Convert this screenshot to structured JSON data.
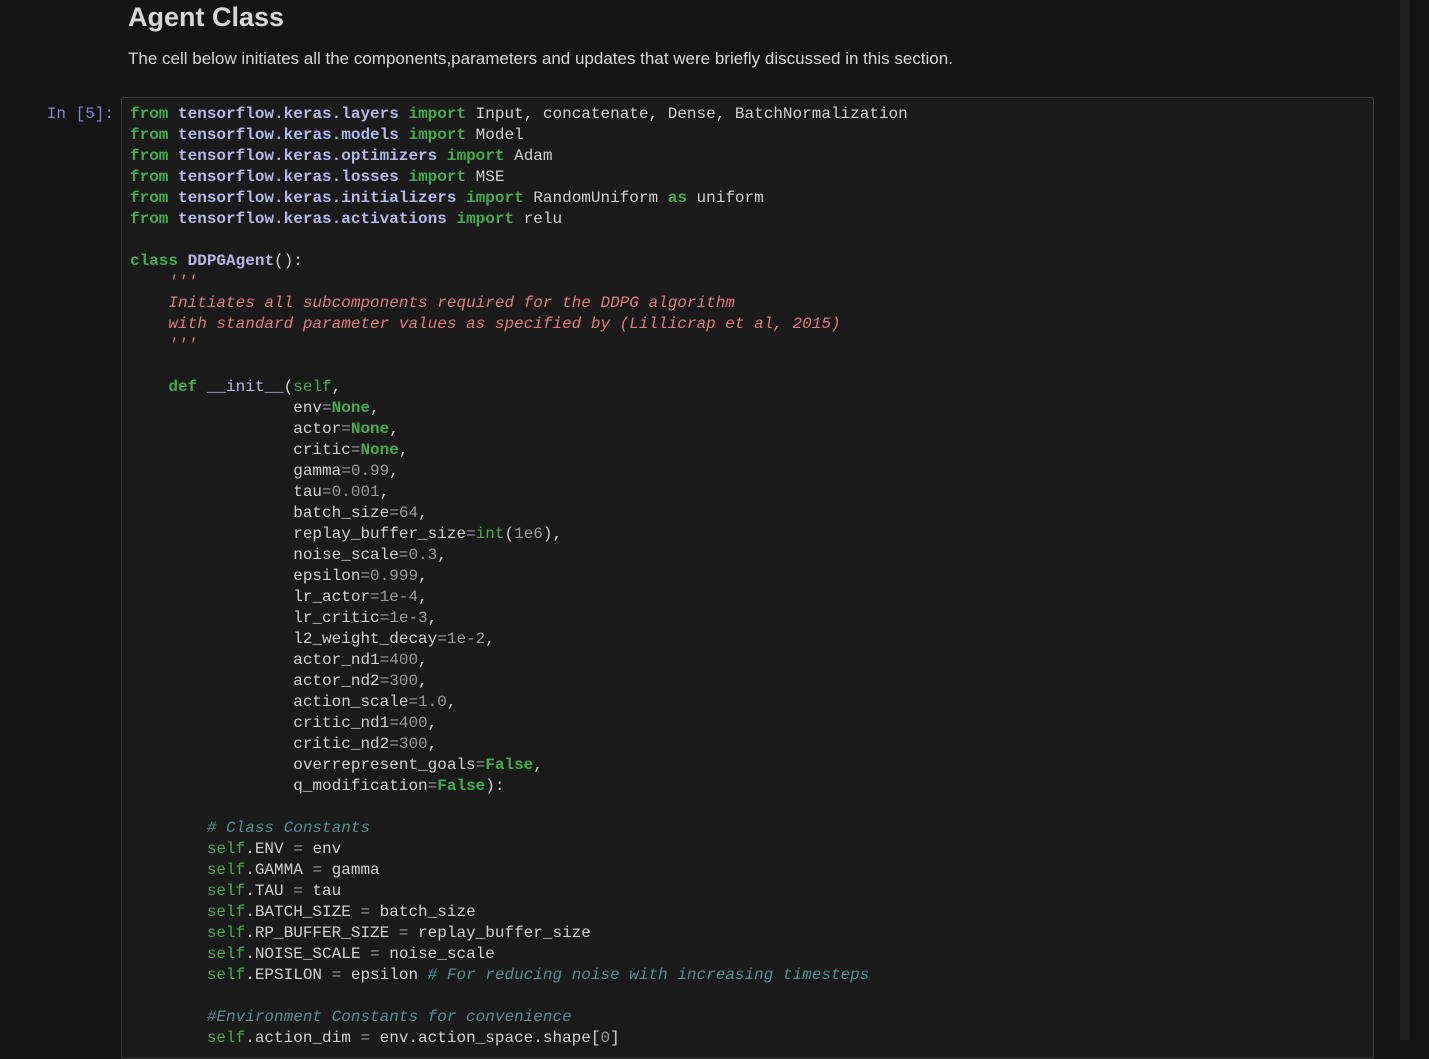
{
  "heading": "Agent Class",
  "description": "The cell below initiates all the components,parameters and updates that were briefly discussed in this section.",
  "cell": {
    "prompt": "In [5]:",
    "lines": [
      [
        [
          "k",
          "from"
        ],
        [
          "n",
          " "
        ],
        [
          "m",
          "tensorflow.keras.layers"
        ],
        [
          "n",
          " "
        ],
        [
          "k",
          "import"
        ],
        [
          "n",
          " Input, concatenate, Dense, BatchNormalization"
        ]
      ],
      [
        [
          "k",
          "from"
        ],
        [
          "n",
          " "
        ],
        [
          "m",
          "tensorflow.keras.models"
        ],
        [
          "n",
          " "
        ],
        [
          "k",
          "import"
        ],
        [
          "n",
          " Model"
        ]
      ],
      [
        [
          "k",
          "from"
        ],
        [
          "n",
          " "
        ],
        [
          "m",
          "tensorflow.keras.optimizers"
        ],
        [
          "n",
          " "
        ],
        [
          "k",
          "import"
        ],
        [
          "n",
          " Adam"
        ]
      ],
      [
        [
          "k",
          "from"
        ],
        [
          "n",
          " "
        ],
        [
          "m",
          "tensorflow.keras.losses"
        ],
        [
          "n",
          " "
        ],
        [
          "k",
          "import"
        ],
        [
          "n",
          " MSE"
        ]
      ],
      [
        [
          "k",
          "from"
        ],
        [
          "n",
          " "
        ],
        [
          "m",
          "tensorflow.keras.initializers"
        ],
        [
          "n",
          " "
        ],
        [
          "k",
          "import"
        ],
        [
          "n",
          " RandomUniform "
        ],
        [
          "k",
          "as"
        ],
        [
          "n",
          " uniform"
        ]
      ],
      [
        [
          "k",
          "from"
        ],
        [
          "n",
          " "
        ],
        [
          "m",
          "tensorflow.keras.activations"
        ],
        [
          "n",
          " "
        ],
        [
          "k",
          "import"
        ],
        [
          "n",
          " relu"
        ]
      ],
      [],
      [
        [
          "k",
          "class"
        ],
        [
          "n",
          " "
        ],
        [
          "fb",
          "DDPGAgent"
        ],
        [
          "n",
          "():"
        ]
      ],
      [
        [
          "s",
          "    '''"
        ]
      ],
      [
        [
          "s",
          "    Initiates all subcomponents required for the DDPG algorithm"
        ]
      ],
      [
        [
          "s",
          "    with standard parameter values as specified by (Lillicrap et al, 2015)"
        ]
      ],
      [
        [
          "s",
          "    '''"
        ]
      ],
      [],
      [
        [
          "n",
          "    "
        ],
        [
          "k",
          "def"
        ],
        [
          "n",
          " "
        ],
        [
          "f",
          "__init__"
        ],
        [
          "n",
          "("
        ],
        [
          "b",
          "self"
        ],
        [
          "n",
          ","
        ]
      ],
      [
        [
          "n",
          "                 env"
        ],
        [
          "o",
          "="
        ],
        [
          "k",
          "None"
        ],
        [
          "n",
          ","
        ]
      ],
      [
        [
          "n",
          "                 actor"
        ],
        [
          "o",
          "="
        ],
        [
          "k",
          "None"
        ],
        [
          "n",
          ","
        ]
      ],
      [
        [
          "n",
          "                 critic"
        ],
        [
          "o",
          "="
        ],
        [
          "k",
          "None"
        ],
        [
          "n",
          ","
        ]
      ],
      [
        [
          "n",
          "                 gamma"
        ],
        [
          "o",
          "=0.99"
        ],
        [
          "n",
          ","
        ]
      ],
      [
        [
          "n",
          "                 tau"
        ],
        [
          "o",
          "=0.001"
        ],
        [
          "n",
          ","
        ]
      ],
      [
        [
          "n",
          "                 batch_size"
        ],
        [
          "o",
          "=64"
        ],
        [
          "n",
          ","
        ]
      ],
      [
        [
          "n",
          "                 replay_buffer_size"
        ],
        [
          "o",
          "="
        ],
        [
          "b",
          "int"
        ],
        [
          "n",
          "("
        ],
        [
          "o",
          "1e6"
        ],
        [
          "n",
          "),"
        ]
      ],
      [
        [
          "n",
          "                 noise_scale"
        ],
        [
          "o",
          "=0.3"
        ],
        [
          "n",
          ","
        ]
      ],
      [
        [
          "n",
          "                 epsilon"
        ],
        [
          "o",
          "=0.999"
        ],
        [
          "n",
          ","
        ]
      ],
      [
        [
          "n",
          "                 lr_actor"
        ],
        [
          "o",
          "=1e-4"
        ],
        [
          "n",
          ","
        ]
      ],
      [
        [
          "n",
          "                 lr_critic"
        ],
        [
          "o",
          "=1e-3"
        ],
        [
          "n",
          ","
        ]
      ],
      [
        [
          "n",
          "                 l2_weight_decay"
        ],
        [
          "o",
          "=1e-2"
        ],
        [
          "n",
          ","
        ]
      ],
      [
        [
          "n",
          "                 actor_nd1"
        ],
        [
          "o",
          "=400"
        ],
        [
          "n",
          ","
        ]
      ],
      [
        [
          "n",
          "                 actor_nd2"
        ],
        [
          "o",
          "=300"
        ],
        [
          "n",
          ","
        ]
      ],
      [
        [
          "n",
          "                 action_scale"
        ],
        [
          "o",
          "=1.0"
        ],
        [
          "n",
          ","
        ]
      ],
      [
        [
          "n",
          "                 critic_nd1"
        ],
        [
          "o",
          "=400"
        ],
        [
          "n",
          ","
        ]
      ],
      [
        [
          "n",
          "                 critic_nd2"
        ],
        [
          "o",
          "=300"
        ],
        [
          "n",
          ","
        ]
      ],
      [
        [
          "n",
          "                 overrepresent_goals"
        ],
        [
          "o",
          "="
        ],
        [
          "k",
          "False"
        ],
        [
          "n",
          ","
        ]
      ],
      [
        [
          "n",
          "                 q_modification"
        ],
        [
          "o",
          "="
        ],
        [
          "k",
          "False"
        ],
        [
          "n",
          "):"
        ]
      ],
      [],
      [
        [
          "c",
          "        # Class Constants"
        ]
      ],
      [
        [
          "n",
          "        "
        ],
        [
          "b",
          "self"
        ],
        [
          "n",
          ".ENV "
        ],
        [
          "o",
          "="
        ],
        [
          "n",
          " env"
        ]
      ],
      [
        [
          "n",
          "        "
        ],
        [
          "b",
          "self"
        ],
        [
          "n",
          ".GAMMA "
        ],
        [
          "o",
          "="
        ],
        [
          "n",
          " gamma"
        ]
      ],
      [
        [
          "n",
          "        "
        ],
        [
          "b",
          "self"
        ],
        [
          "n",
          ".TAU "
        ],
        [
          "o",
          "="
        ],
        [
          "n",
          " tau"
        ]
      ],
      [
        [
          "n",
          "        "
        ],
        [
          "b",
          "self"
        ],
        [
          "n",
          ".BATCH_SIZE "
        ],
        [
          "o",
          "="
        ],
        [
          "n",
          " batch_size"
        ]
      ],
      [
        [
          "n",
          "        "
        ],
        [
          "b",
          "self"
        ],
        [
          "n",
          ".RP_BUFFER_SIZE "
        ],
        [
          "o",
          "="
        ],
        [
          "n",
          " replay_buffer_size"
        ]
      ],
      [
        [
          "n",
          "        "
        ],
        [
          "b",
          "self"
        ],
        [
          "n",
          ".NOISE_SCALE "
        ],
        [
          "o",
          "="
        ],
        [
          "n",
          " noise_scale"
        ]
      ],
      [
        [
          "n",
          "        "
        ],
        [
          "b",
          "self"
        ],
        [
          "n",
          ".EPSILON "
        ],
        [
          "o",
          "="
        ],
        [
          "n",
          " epsilon "
        ],
        [
          "c",
          "# For reducing noise with increasing timesteps"
        ]
      ],
      [],
      [
        [
          "c",
          "        #Environment Constants for convenience"
        ]
      ],
      [
        [
          "n",
          "        "
        ],
        [
          "b",
          "self"
        ],
        [
          "n",
          ".action_dim "
        ],
        [
          "o",
          "="
        ],
        [
          "n",
          " env.action_space.shape["
        ],
        [
          "o",
          "0"
        ],
        [
          "n",
          "]"
        ]
      ]
    ]
  }
}
